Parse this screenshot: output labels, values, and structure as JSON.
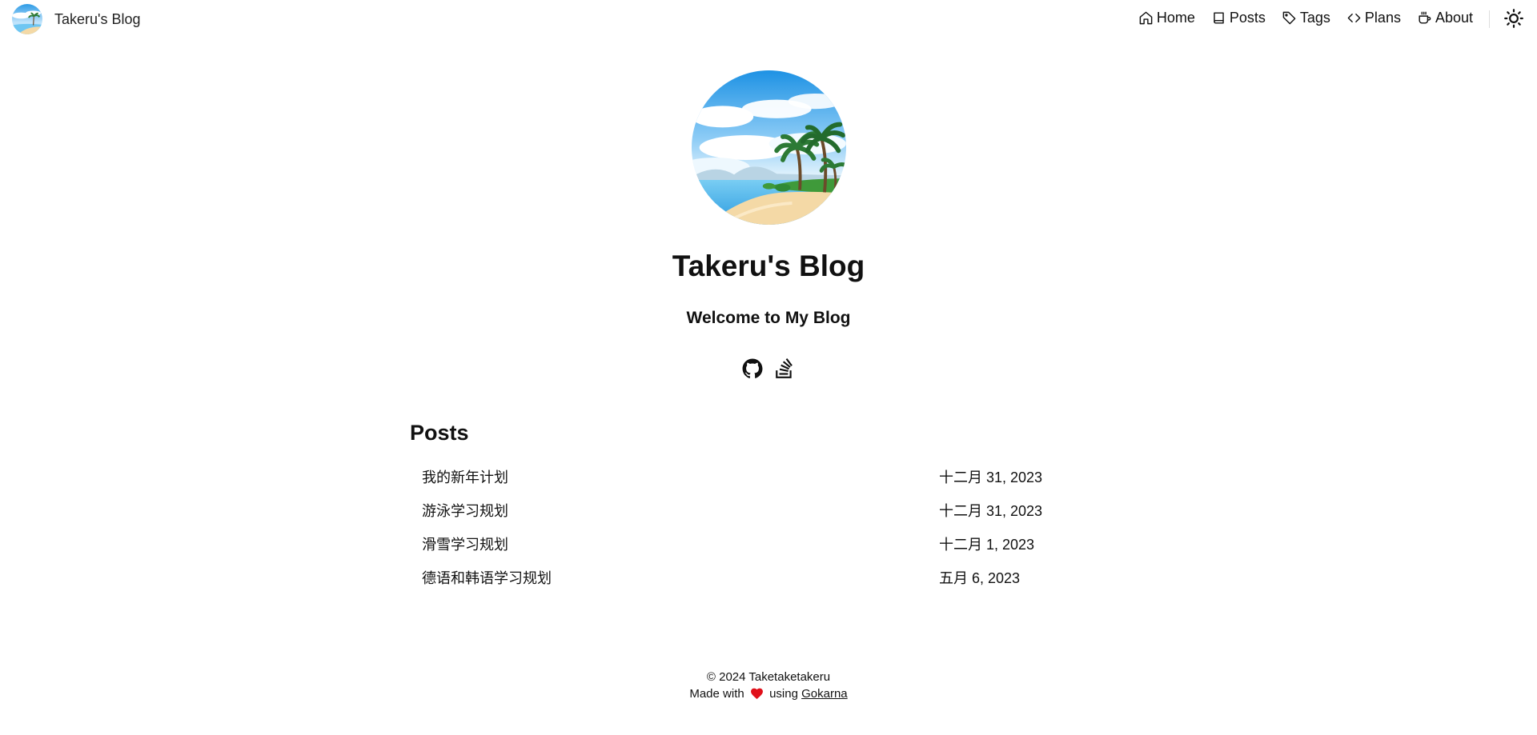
{
  "header": {
    "brand_title": "Takeru's Blog",
    "nav": [
      {
        "label": "Home",
        "icon": "home-icon"
      },
      {
        "label": "Posts",
        "icon": "book-icon"
      },
      {
        "label": "Tags",
        "icon": "tag-icon"
      },
      {
        "label": "Plans",
        "icon": "code-icon"
      },
      {
        "label": "About",
        "icon": "coffee-icon"
      }
    ],
    "theme_toggle_icon": "sun-icon"
  },
  "hero": {
    "title": "Takeru's Blog",
    "subtitle": "Welcome to My Blog",
    "social": [
      "github-icon",
      "stackoverflow-icon"
    ]
  },
  "posts": {
    "heading": "Posts",
    "items": [
      {
        "title": "我的新年计划",
        "date": "十二月 31, 2023"
      },
      {
        "title": "游泳学习规划",
        "date": "十二月 31, 2023"
      },
      {
        "title": "滑雪学习规划",
        "date": "十二月 1, 2023"
      },
      {
        "title": "德语和韩语学习规划",
        "date": "五月 6, 2023"
      }
    ]
  },
  "footer": {
    "copyright": "© 2024 Taketaketakeru",
    "made_with": "Made with",
    "using": "using",
    "link_label": "Gokarna"
  },
  "colors": {
    "heart": "#e0101a",
    "sky": "#3aa7e8",
    "sand": "#f4d9a6",
    "palm": "#2c7a35"
  }
}
